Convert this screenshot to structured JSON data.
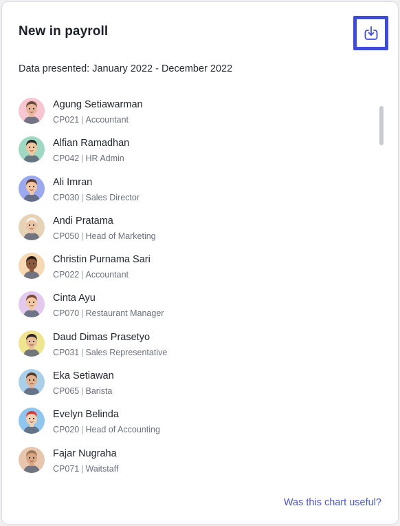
{
  "card": {
    "title": "New in payroll",
    "subtitle": "Data presented: January 2022 - December 2022",
    "download_icon": "download-icon",
    "feedback_link": "Was this chart useful?"
  },
  "separator": "|",
  "employees": [
    {
      "name": "Agung Setiawarman",
      "code": "CP021",
      "role": "Accountant",
      "bg": "#f7c6d0",
      "skin": "#e8b59a",
      "hair": "#6b4a3a"
    },
    {
      "name": "Alfian Ramadhan",
      "code": "CP042",
      "role": "HR Admin",
      "bg": "#9fd9c4",
      "skin": "#f0c79e",
      "hair": "#2c2c2c"
    },
    {
      "name": "Ali Imran",
      "code": "CP030",
      "role": "Sales Director",
      "bg": "#9aa9f0",
      "skin": "#f2c7a6",
      "hair": "#5a3b2a"
    },
    {
      "name": "Andi Pratama",
      "code": "CP050",
      "role": "Head of Marketing",
      "bg": "#e6d2b5",
      "skin": "#e9c4a6",
      "hair": "#f2f2f2"
    },
    {
      "name": "Christin Purnama Sari",
      "code": "CP022",
      "role": "Accountant",
      "bg": "#f6d8b2",
      "skin": "#8a5a3c",
      "hair": "#2a1d16"
    },
    {
      "name": "Cinta Ayu",
      "code": "CP070",
      "role": "Restaurant Manager",
      "bg": "#e4c9ef",
      "skin": "#f0c8a4",
      "hair": "#7a4a33"
    },
    {
      "name": "Daud Dimas Prasetyo",
      "code": "CP031",
      "role": "Sales Representative",
      "bg": "#efe58e",
      "skin": "#e7bc98",
      "hair": "#2f2522"
    },
    {
      "name": "Eka Setiawan",
      "code": "CP065",
      "role": "Barista",
      "bg": "#a9cfe9",
      "skin": "#e2b28e",
      "hair": "#5b3d2c"
    },
    {
      "name": "Evelyn Belinda",
      "code": "CP020",
      "role": "Head of Accounting",
      "bg": "#8fc6ef",
      "skin": "#f1cfb2",
      "hair": "#d8383a"
    },
    {
      "name": "Fajar Nugraha",
      "code": "CP071",
      "role": "Waitstaff",
      "bg": "#e8c5ad",
      "skin": "#d9a583",
      "hair": "#a07658"
    }
  ]
}
